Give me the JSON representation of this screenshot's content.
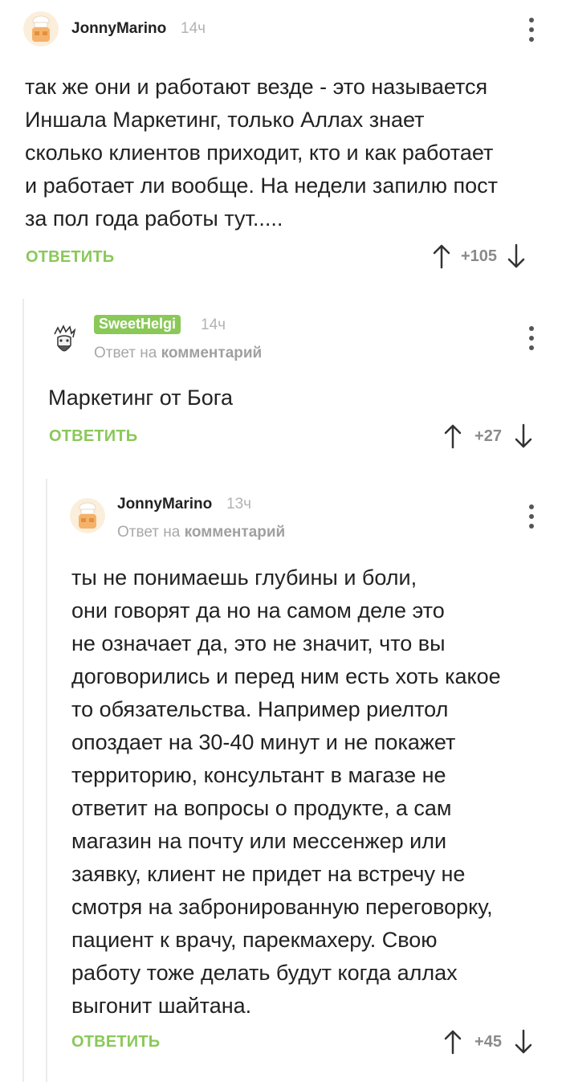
{
  "comments": [
    {
      "author": "JonnyMarino",
      "time": "14ч",
      "reply_to_prefix": "",
      "reply_to_target": "",
      "text": "так же они и работают везде - это называется\nИншала Маркетинг, только Аллах знает\nсколько клиентов приходит, кто и как работает\nи работает ли вообще. На недели запилю пост\nза пол года работы тут.....",
      "reply_label": "ОТВЕТИТЬ",
      "score": "+105"
    },
    {
      "author": "SweetHelgi",
      "time": "14ч",
      "reply_to_prefix": "Ответ на",
      "reply_to_target": "комментарий",
      "text": "Маркетинг от Бога",
      "reply_label": "ОТВЕТИТЬ",
      "score": "+27"
    },
    {
      "author": "JonnyMarino",
      "time": "13ч",
      "reply_to_prefix": "Ответ на",
      "reply_to_target": "комментарий",
      "text": "ты не понимаешь глубины и боли,\nони говорят да но на самом деле это\nне означает да, это не значит, что вы\nдоговорились и перед ним есть хоть какое\nто обязательства. Например риелтол\nопоздает на 30-40 минут и не покажет\nтерриторию, консультант в магазе не\nответит на вопросы о продукте, а сам\nмагазин на почту  или мессенжер или\nзаявку,  клиент не придет на встречу не\nсмотря на забронированную переговорку,\nпациент к врачу, парекмахеру. Свою\nработу тоже делать будут когда аллах\nвыгонит шайтана.",
      "reply_label": "ОТВЕТИТЬ",
      "score": "+45"
    }
  ],
  "colors": {
    "accent": "#8ac858",
    "text": "#222222",
    "muted": "#b3b3b3"
  },
  "icons": {
    "avatar_1": "chef-avatar",
    "avatar_2": "bearded-face-avatar",
    "menu": "more-vertical-icon",
    "up": "arrow-up-icon",
    "down": "arrow-down-icon"
  }
}
